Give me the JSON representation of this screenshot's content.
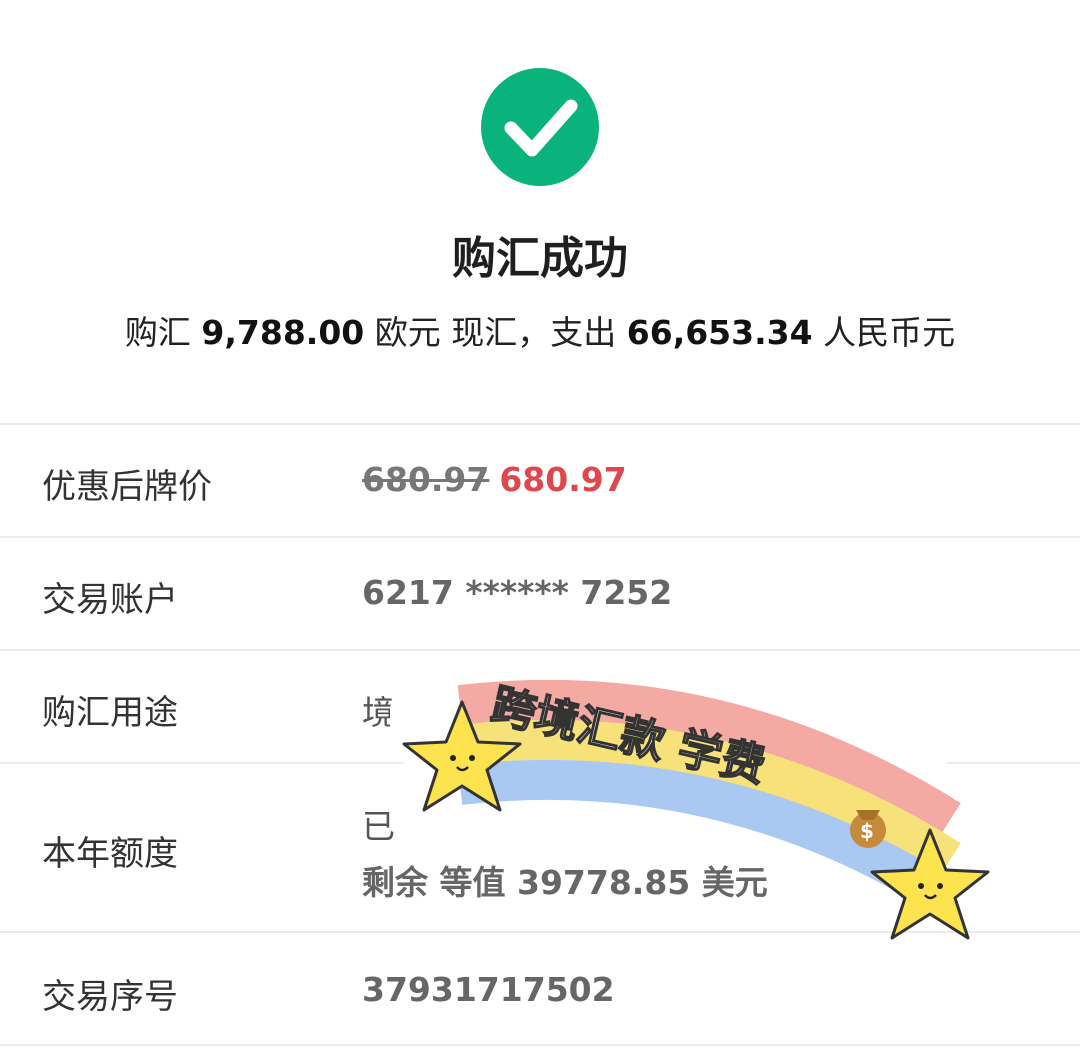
{
  "result": {
    "title": "购汇成功",
    "summary": {
      "prefix": "购汇",
      "amount": "9,788.00",
      "currency": "欧元 现汇，支出",
      "spend": "66,653.34",
      "spend_currency": "人民币元"
    }
  },
  "details": {
    "rate": {
      "label": "优惠后牌价",
      "original": "680.97",
      "discounted": "680.97"
    },
    "account": {
      "label": "交易账户",
      "value": "6217 ****** 7252"
    },
    "purpose": {
      "label": "购汇用途",
      "value": "境外"
    },
    "quota": {
      "label": "本年额度",
      "line1": "已",
      "line2": "剩余 等值 39778.85 美元"
    },
    "serial": {
      "label": "交易序号",
      "value": "37931717502"
    }
  },
  "sticker": {
    "text": "跨境汇款 学费",
    "icon": "money-bag-icon"
  },
  "colors": {
    "success": "#0ab27c",
    "discount": "#e0474c"
  }
}
